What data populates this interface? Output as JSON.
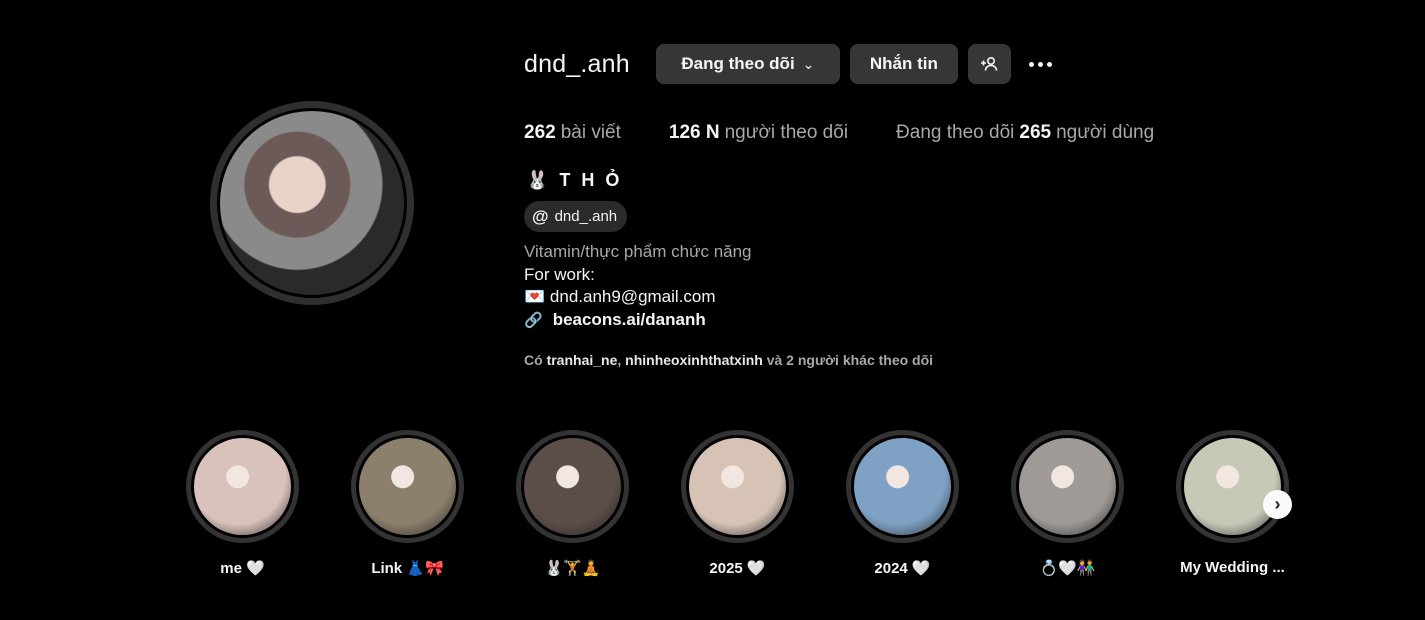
{
  "profile": {
    "username": "dnd_.anh",
    "following_button": "Đang theo dõi",
    "message_button": "Nhắn tin",
    "full_name": "🐰 T H Ỏ",
    "threads_handle": "dnd_.anh"
  },
  "stats": {
    "posts_count": "262",
    "posts_label": "bài viết",
    "followers_count": "126 N",
    "followers_label": "người theo dõi",
    "following_prefix": "Đang theo dõi",
    "following_count": "265",
    "following_label": "người dùng"
  },
  "bio": {
    "category": "Vitamin/thực phẩm chức năng",
    "line1": "For work:",
    "email_emoji": "💌",
    "email": "dnd.anh9@gmail.com",
    "link": "beacons.ai/dananh"
  },
  "mutuals": {
    "prefix": "Có",
    "account1": "tranhai_ne",
    "separator": ",",
    "account2": "nhinheoxinhthatxinh",
    "suffix": "và 2 người khác theo dõi"
  },
  "highlights": [
    {
      "label": "me 🤍",
      "color": "#d9c2bb"
    },
    {
      "label": "Link 👗🎀",
      "color": "#8c7f6b"
    },
    {
      "label": "🐰🏋️🧘",
      "color": "#5b4e48"
    },
    {
      "label": "2025 🤍",
      "color": "#d6c3b5"
    },
    {
      "label": "2024 🤍",
      "color": "#7fa1c4"
    },
    {
      "label": "💍🤍👫",
      "color": "#9f9a96"
    },
    {
      "label": "My Wedding ...",
      "color": "#c7c9b7"
    }
  ],
  "icons": {
    "chevron": "⌄",
    "add_user": "+👤",
    "threads": "@",
    "link": "🔗",
    "next": "›"
  },
  "colors": {
    "background": "#000000",
    "button": "#363636",
    "muted_text": "#a8a8a8"
  }
}
